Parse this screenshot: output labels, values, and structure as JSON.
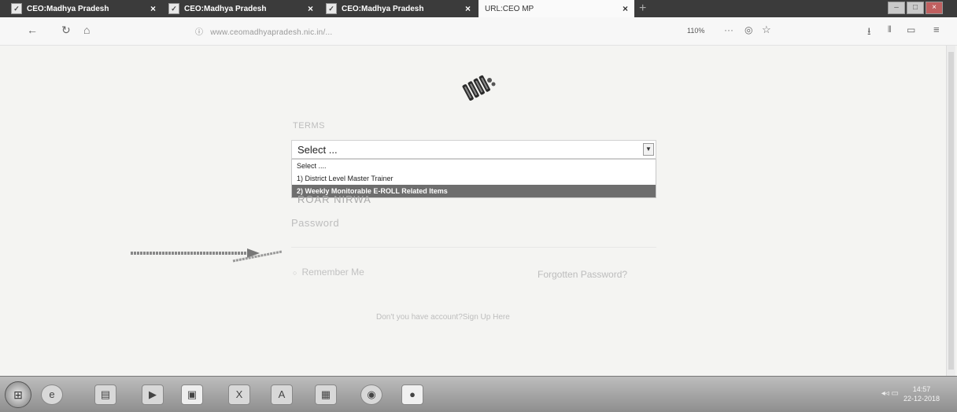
{
  "tabs": [
    {
      "label": "CEO:Madhya Pradesh"
    },
    {
      "label": "CEO:Madhya Pradesh"
    },
    {
      "label": "CEO:Madhya Pradesh"
    },
    {
      "label": "URL:CEO MP"
    }
  ],
  "nav": {
    "url": "www.ceomadhyapradesh.nic.in/...",
    "zoom": "110%",
    "more": "···"
  },
  "form": {
    "top_label": "TERMS",
    "select_value": "Select ...",
    "options": [
      "Select ....",
      "1) District Level Master Trainer",
      "2) Weekly Monitorable E-ROLL Related Items"
    ],
    "username_value": "ROAR NIRWA",
    "password_label": "Password",
    "remember_label": "Remember Me",
    "forgot_label": "Forgotten Password?",
    "signup_text": "Don't you have account?Sign Up Here"
  },
  "taskbar": {
    "time": "14:57",
    "date": "22-12-2018"
  }
}
